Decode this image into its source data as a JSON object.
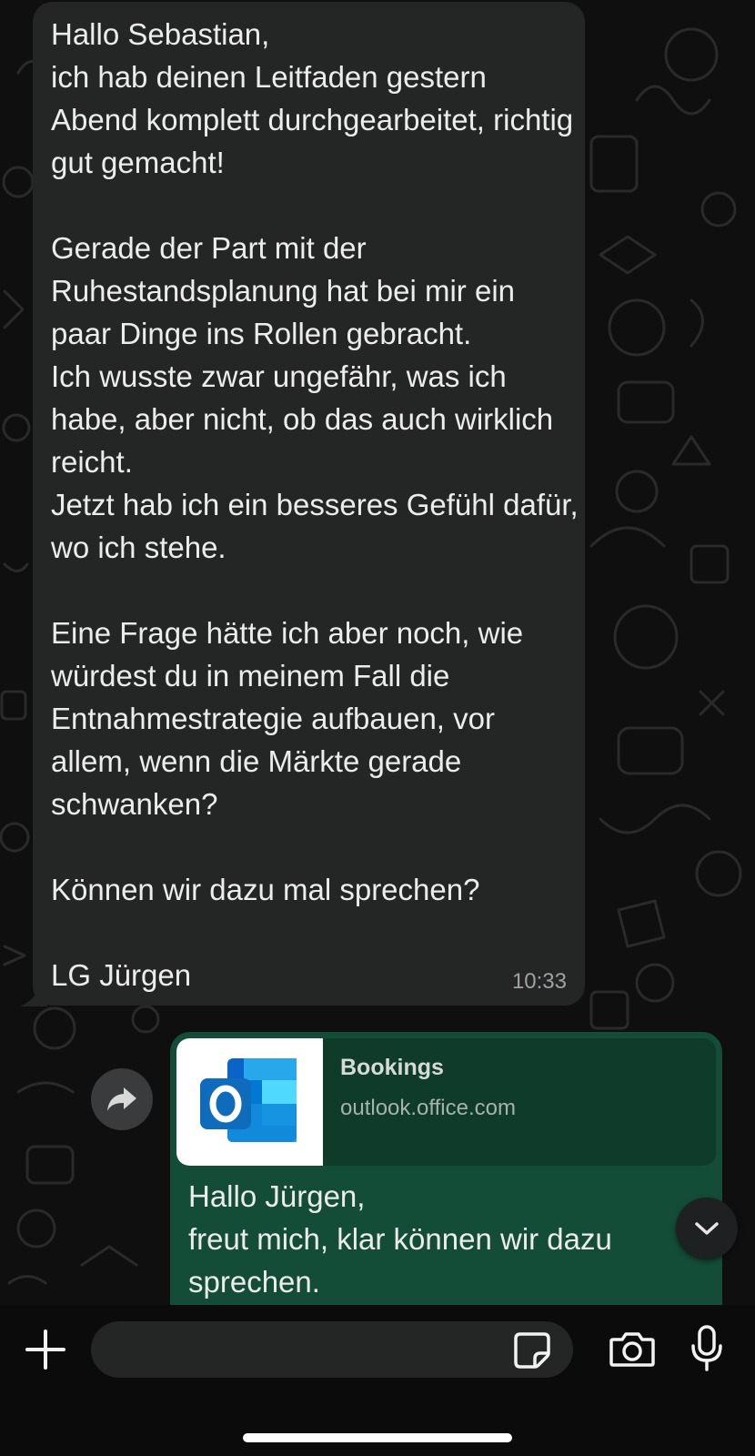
{
  "incoming_message": {
    "text": "Hallo Sebastian,\nich hab deinen Leitfaden gestern Abend komplett durchgearbeitet, richtig gut gemacht!\n\nGerade der Part mit der Ruhestandsplanung hat bei mir ein paar Dinge ins Rollen gebracht.\nIch wusste zwar ungefähr, was ich habe, aber nicht, ob das auch wirklich reicht.\nJetzt hab ich ein besseres Gefühl dafür, wo ich stehe.\n\nEine Frage hätte ich aber noch, wie würdest du in meinem Fall die Entnahmestrategie aufbauen, vor allem, wenn die Märkte gerade schwanken?\n\nKönnen wir dazu mal sprechen?\n\nLG Jürgen",
    "time": "10:33"
  },
  "outgoing_message": {
    "link_preview": {
      "title": "Bookings",
      "domain": "outlook.office.com",
      "thumbnail_icon": "outlook-logo-icon"
    },
    "text": "Hallo Jürgen,\nfreut mich, klar können wir dazu sprechen."
  },
  "composer": {
    "input_value": "",
    "input_placeholder": "",
    "icons": [
      "plus-icon",
      "sticker-icon",
      "camera-icon",
      "microphone-icon"
    ]
  },
  "buttons": {
    "forward_icon": "forward-arrow-icon",
    "scroll_down_icon": "chevron-down-icon"
  },
  "colors": {
    "incoming_bubble": "#242626",
    "outgoing_bubble": "#144d37",
    "link_preview_bg": "#0f3b2b",
    "background": "#0b0b0b"
  }
}
